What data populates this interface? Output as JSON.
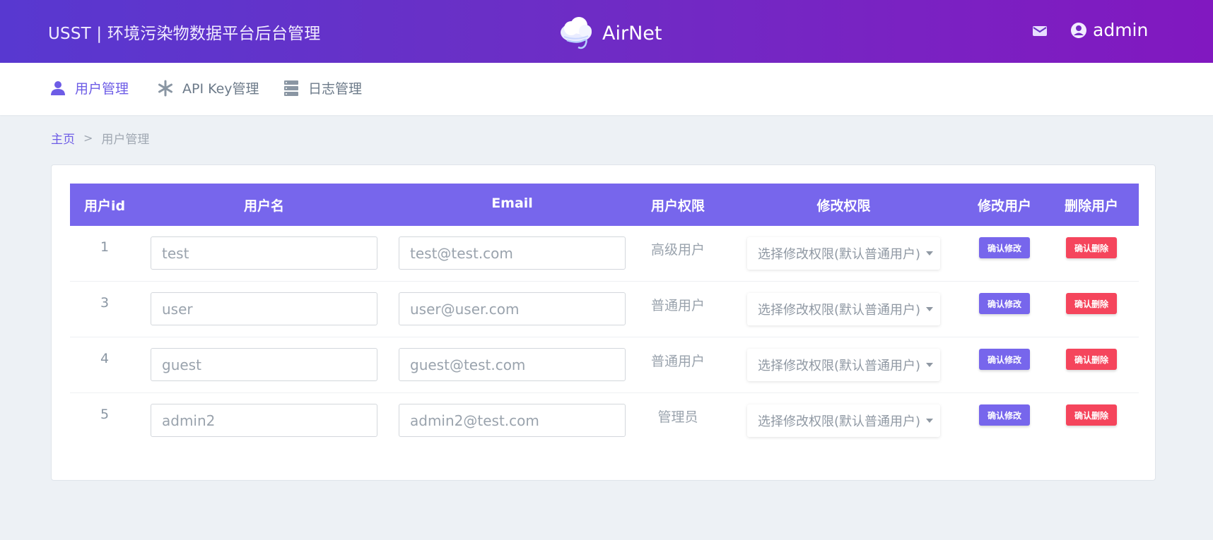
{
  "header": {
    "title": "USST | 环境污染物数据平台后台管理",
    "logo_text": "AirNet",
    "user": "admin"
  },
  "nav": [
    {
      "label": "用户管理",
      "icon": "user-icon",
      "active": true
    },
    {
      "label": "API Key管理",
      "icon": "asterisk-icon",
      "active": false
    },
    {
      "label": "日志管理",
      "icon": "server-icon",
      "active": false
    }
  ],
  "breadcrumb": {
    "home": "主页",
    "separator": ">",
    "current": "用户管理"
  },
  "table": {
    "headers": [
      "用户id",
      "用户名",
      "Email",
      "用户权限",
      "修改权限",
      "修改用户",
      "删除用户"
    ],
    "select_placeholder": "选择修改权限(默认普通用户)",
    "edit_button": "确认修改",
    "delete_button": "确认删除",
    "rows": [
      {
        "id": "1",
        "username": "test",
        "email": "test@test.com",
        "permission": "高级用户"
      },
      {
        "id": "3",
        "username": "user",
        "email": "user@user.com",
        "permission": "普通用户"
      },
      {
        "id": "4",
        "username": "guest",
        "email": "guest@test.com",
        "permission": "普通用户"
      },
      {
        "id": "5",
        "username": "admin2",
        "email": "admin2@test.com",
        "permission": "管理员"
      }
    ]
  },
  "colors": {
    "primary": "#7766ec",
    "danger": "#f5455c",
    "header_start": "#5838d0",
    "header_end": "#8118c0"
  }
}
